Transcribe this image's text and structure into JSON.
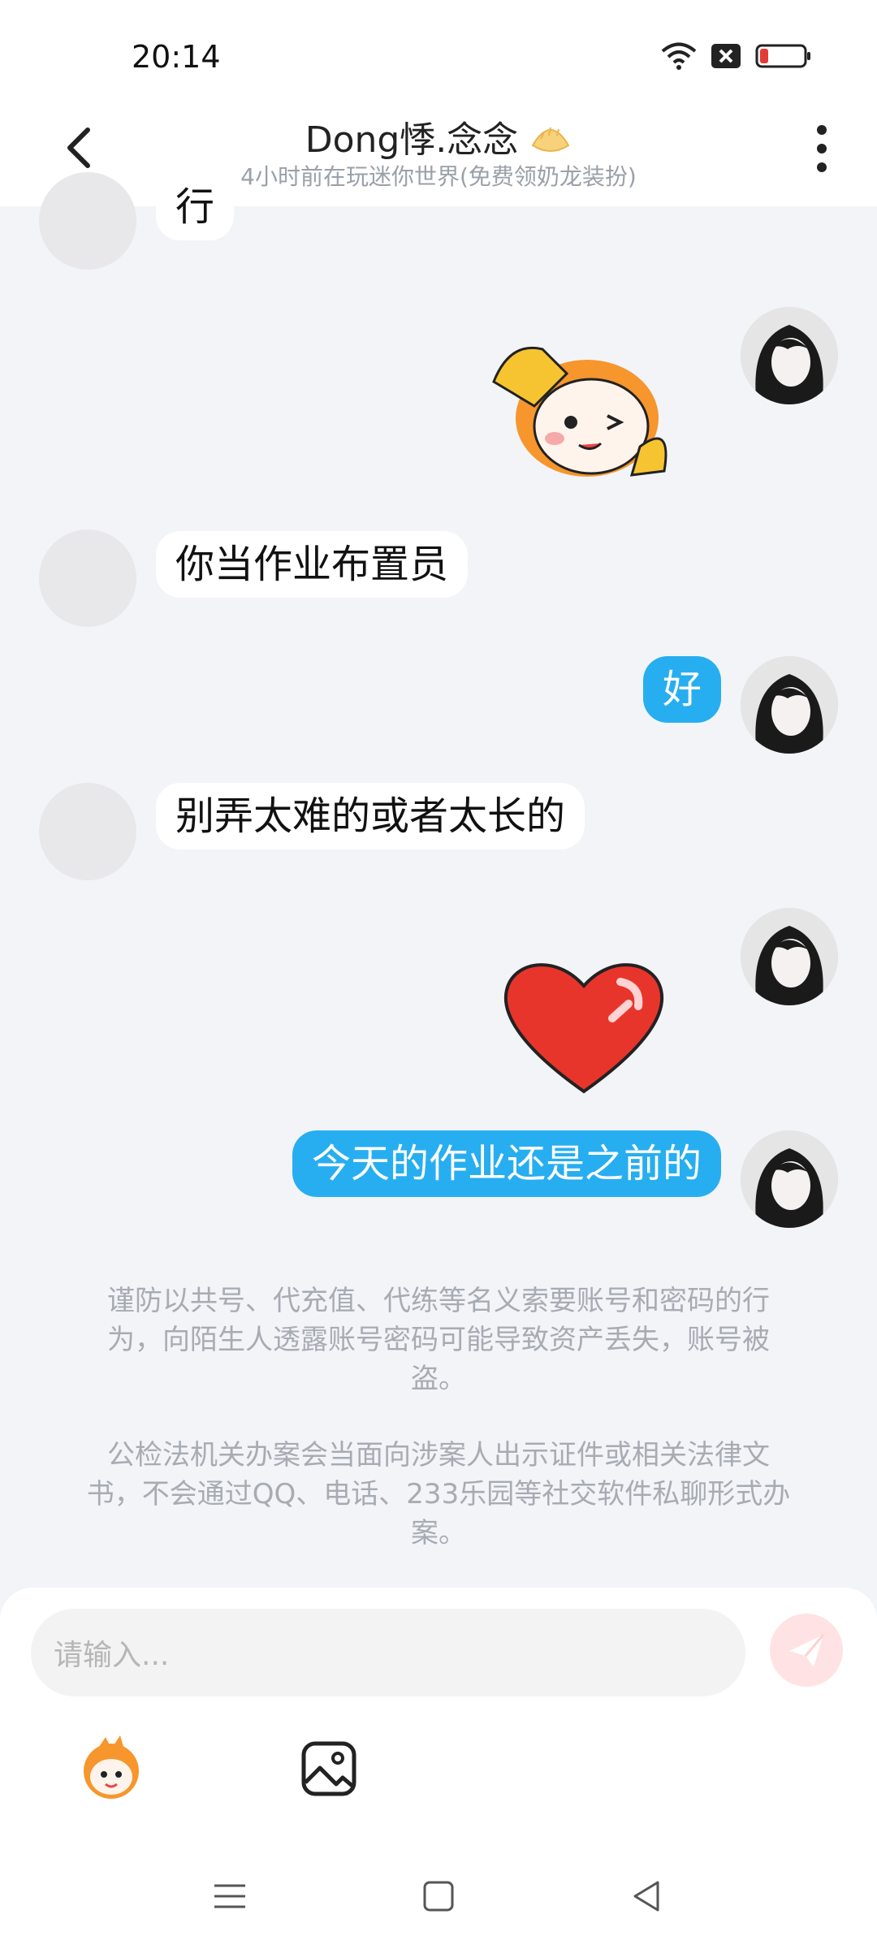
{
  "status": {
    "time": "20:14"
  },
  "header": {
    "title": "Dong悸.念念",
    "subtitle": "4小时前在玩迷你世界(免费领奶龙装扮)"
  },
  "messages": [
    {
      "side": "left",
      "type": "text",
      "text": "行"
    },
    {
      "side": "right",
      "type": "sticker",
      "sticker": "thumbs-up-sticker"
    },
    {
      "side": "left",
      "type": "text",
      "text": "你当作业布置员"
    },
    {
      "side": "right",
      "type": "text",
      "text": "好"
    },
    {
      "side": "left",
      "type": "text",
      "text": "别弄太难的或者太长的"
    },
    {
      "side": "right",
      "type": "sticker",
      "sticker": "heart-sticker"
    },
    {
      "side": "right",
      "type": "text",
      "text": "今天的作业还是之前的"
    }
  ],
  "notices": [
    "谨防以共号、代充值、代练等名义索要账号和密码的行为，向陌生人透露账号密码可能导致资产丢失，账号被盗。",
    "公检法机关办案会当面向涉案人出示证件或相关法律文书，不会通过QQ、电话、233乐园等社交软件私聊形式办案。"
  ],
  "input": {
    "placeholder": "请输入..."
  },
  "colors": {
    "bubble_right": "#27aef0",
    "send_button": "#ffe2e3",
    "background": "#f2f4f8"
  }
}
